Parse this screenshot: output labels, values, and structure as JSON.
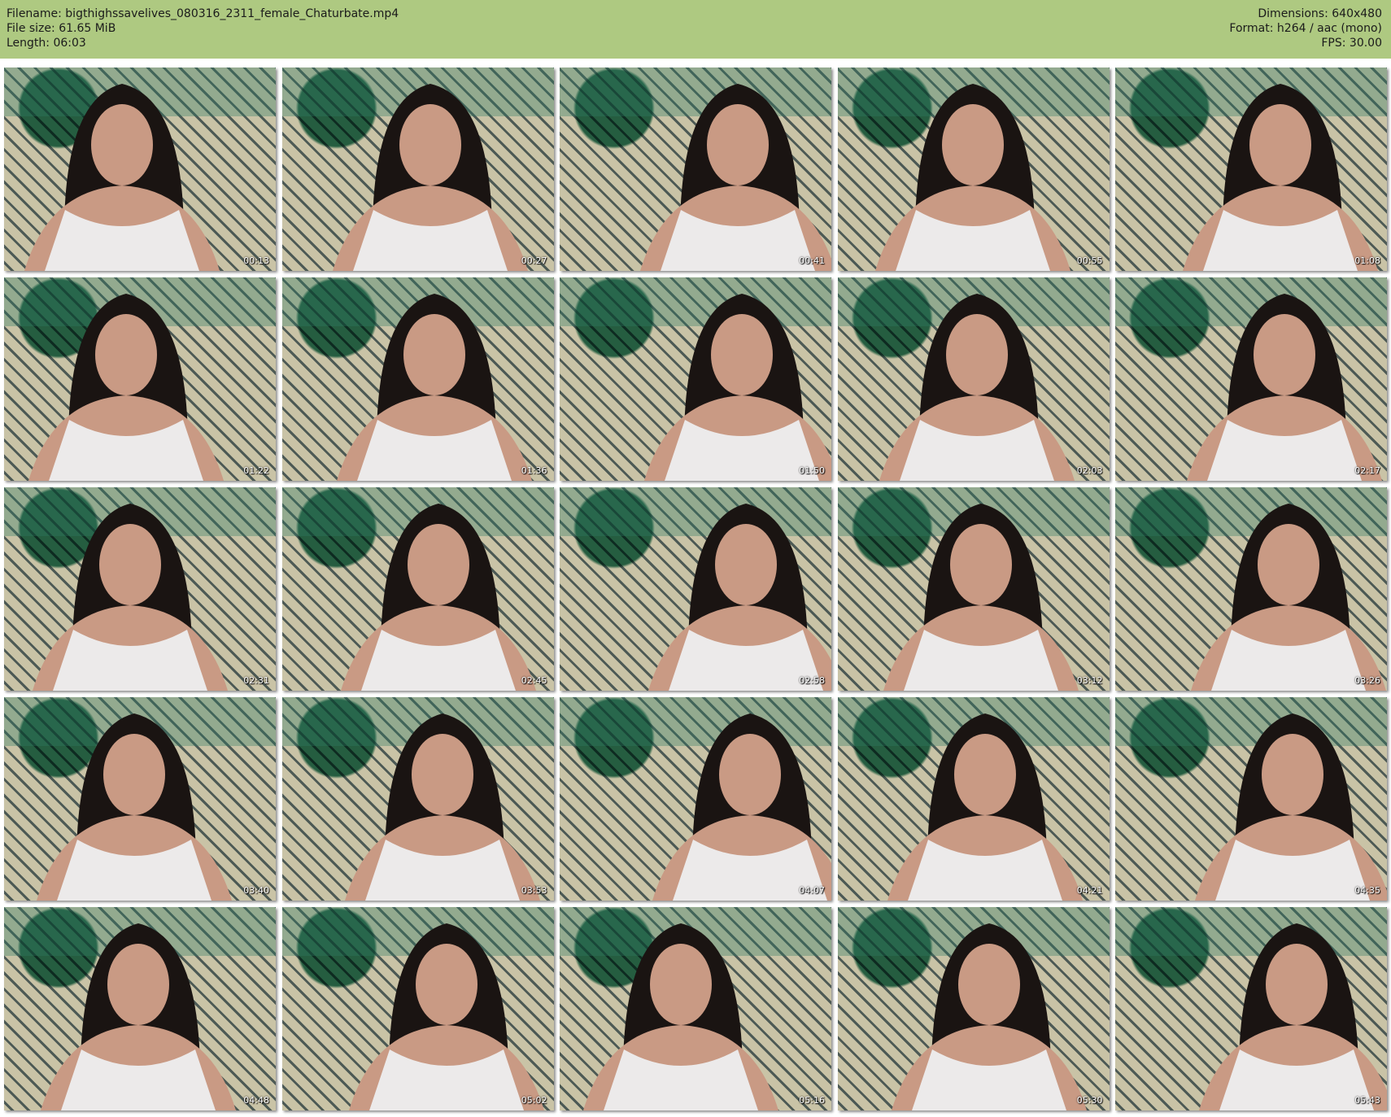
{
  "header": {
    "filename_line": "Filename: bigthighssavelives_080316_2311_female_Chaturbate.mp4",
    "filesize_line": "File size: 61.65 MiB",
    "length_line": "Length: 06:03",
    "dimensions_line": "Dimensions: 640x480",
    "format_line": "Format: h264 / aac (mono)",
    "fps_line": "FPS: 30.00"
  },
  "thumbnails": [
    {
      "time": "00:13"
    },
    {
      "time": "00:27"
    },
    {
      "time": "00:41"
    },
    {
      "time": "00:55"
    },
    {
      "time": "01:08"
    },
    {
      "time": "01:22"
    },
    {
      "time": "01:36"
    },
    {
      "time": "01:50"
    },
    {
      "time": "02:03"
    },
    {
      "time": "02:17"
    },
    {
      "time": "02:31"
    },
    {
      "time": "02:45"
    },
    {
      "time": "02:58"
    },
    {
      "time": "03:12"
    },
    {
      "time": "03:26"
    },
    {
      "time": "03:40"
    },
    {
      "time": "03:53"
    },
    {
      "time": "04:07"
    },
    {
      "time": "04:21"
    },
    {
      "time": "04:35"
    },
    {
      "time": "04:48"
    },
    {
      "time": "05:02"
    },
    {
      "time": "05:16"
    },
    {
      "time": "05:30"
    },
    {
      "time": "05:43"
    }
  ],
  "colors": {
    "header_bg": "#aec981",
    "tapestry_light": "#c9c3a6",
    "tapestry_dark": "#4d5a55",
    "tapestry_accent": "#2f7a63",
    "hair": "#1a1412",
    "skin": "#c99a84",
    "top_white": "#eceaea"
  }
}
